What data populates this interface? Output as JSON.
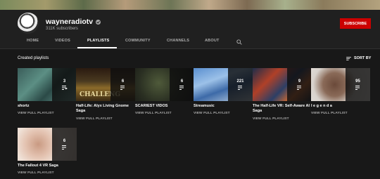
{
  "channel": {
    "name": "wayneradiotv",
    "subscribers": "311K subscribers",
    "subscribe_label": "SUBSCRIBE"
  },
  "tabs": [
    {
      "label": "HOME"
    },
    {
      "label": "VIDEOS"
    },
    {
      "label": "PLAYLISTS"
    },
    {
      "label": "COMMUNITY"
    },
    {
      "label": "CHANNELS"
    },
    {
      "label": "ABOUT"
    }
  ],
  "active_tab": "PLAYLISTS",
  "section": {
    "title": "Created playlists",
    "sort_label": "SORT BY"
  },
  "playlists": [
    {
      "title": "shortz",
      "count": "3",
      "link": "VIEW FULL PLAYLIST",
      "thumb_text": ""
    },
    {
      "title": "Half-Life: Alyx Living Gnome Saga",
      "count": "6",
      "link": "VIEW FULL PLAYLIST",
      "thumb_text": "CHALLENG"
    },
    {
      "title": "SCARIEST VIDOS",
      "count": "6",
      "link": "VIEW FULL PLAYLIST",
      "thumb_text": ""
    },
    {
      "title": "Streamusic",
      "count": "221",
      "link": "VIEW FULL PLAYLIST",
      "thumb_text": ""
    },
    {
      "title": "The Half-Life VR: Self-Aware AI Saga",
      "count": "9",
      "link": "VIEW FULL PLAYLIST",
      "thumb_text": ""
    },
    {
      "title": "l e g e n d a",
      "count": "95",
      "link": "VIEW FULL PLAYLIST",
      "thumb_text": ""
    },
    {
      "title": "The Fallout 4 VR Saga",
      "count": "6",
      "link": "VIEW FULL PLAYLIST",
      "thumb_text": ""
    }
  ],
  "colors": {
    "background": "#181818",
    "header": "#202020",
    "subscribe": "#cc0000",
    "muted": "#aaaaaa"
  },
  "icons": {
    "search": "search-icon",
    "sort": "sort-icon",
    "playlist": "playlist-icon",
    "verified": "verified-icon"
  }
}
